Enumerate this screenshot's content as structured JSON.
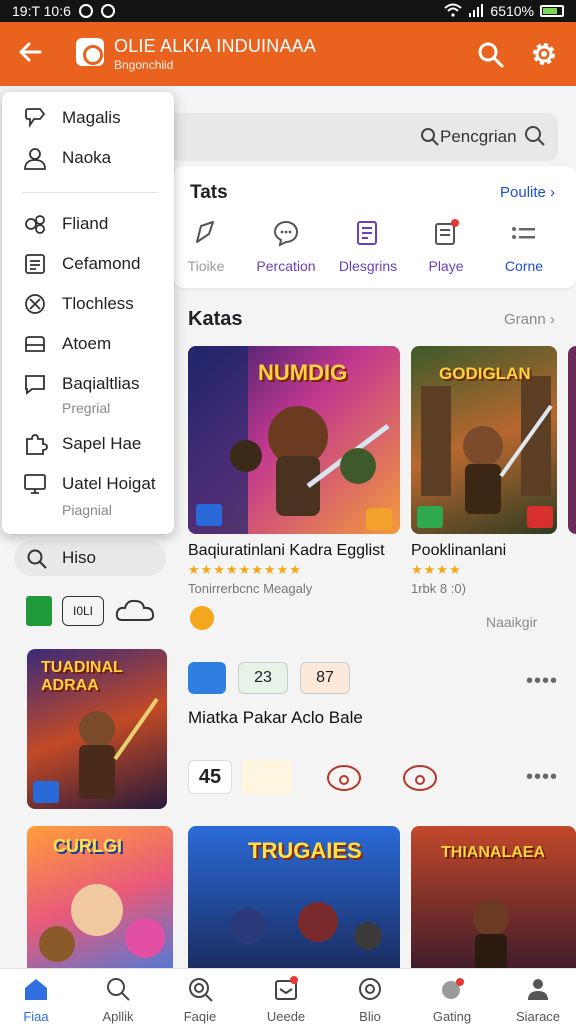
{
  "status_bar": {
    "time": "19:T 10:6",
    "battery": "6510%"
  },
  "app_bar": {
    "title": "OLIE ALKIA INDUINAAA",
    "subtitle": "Bngonchiid"
  },
  "search": {
    "placeholder": "Pencgrian"
  },
  "drawer": {
    "items": [
      {
        "icon": "tag-icon",
        "label": "Magalis"
      },
      {
        "icon": "person-icon",
        "label": "Naoka"
      },
      {
        "icon": "gear-cluster-icon",
        "label": "Fliand"
      },
      {
        "icon": "document-icon",
        "label": "Cefamond"
      },
      {
        "icon": "target-icon",
        "label": "Tlochless"
      },
      {
        "icon": "folder-icon",
        "label": "Atoem"
      },
      {
        "icon": "chat-icon",
        "label": "Baqialtlias",
        "sub": "Pregrial"
      },
      {
        "icon": "puzzle-icon",
        "label": "Sapel Hae"
      },
      {
        "icon": "monitor-icon",
        "label": "Uatel Hoigat",
        "sub": "Piagnial"
      }
    ]
  },
  "categories_card": {
    "title": "Tats",
    "link": "Poulite",
    "items": [
      {
        "label": "Tioike",
        "icon": "tag-icon"
      },
      {
        "label": "Percation",
        "icon": "chat-bubble-icon"
      },
      {
        "label": "Dlesgrins",
        "icon": "list-icon"
      },
      {
        "label": "Playe",
        "icon": "clipboard-icon"
      },
      {
        "label": "Corne",
        "icon": "menu-dots-icon"
      }
    ]
  },
  "section_katas": {
    "title": "Katas",
    "more": "Grann",
    "games": [
      {
        "art_title": "NUMDIG",
        "title": "Baqiuratinlani Kadra Egglist",
        "stars": "★★★★★★★★★",
        "meta": "Tonirrerbcnc Meagaly"
      },
      {
        "art_title": "GODIGLAN",
        "title": "Pooklinanlani",
        "stars": "★★★★",
        "meta": "1rbk 8 :0)"
      }
    ],
    "ad_tag": "Naaikgir"
  },
  "side": {
    "hiso_label": "Hiso",
    "mini_badge": "I0LI"
  },
  "apps_row": {
    "items": [
      {
        "text": ""
      },
      {
        "text": "23"
      },
      {
        "text": "87"
      }
    ],
    "title": "Miatka Pakar Aclo Bale",
    "second_row_text": "45"
  },
  "left_poster": {
    "art_title": "TUADINAL ADRAA"
  },
  "bottom_posters": [
    {
      "art_title": "CURLGI"
    },
    {
      "art_title": "TRUGAIES"
    },
    {
      "art_title": "THIANALAEA"
    }
  ],
  "bottom_nav": {
    "items": [
      {
        "label": "Fiaa",
        "icon": "home-icon",
        "active": true
      },
      {
        "label": "Apllik",
        "icon": "search-icon"
      },
      {
        "label": "Faqie",
        "icon": "magnifier-doc-icon"
      },
      {
        "label": "Ueede",
        "icon": "inbox-icon"
      },
      {
        "label": "Blio",
        "icon": "circle-icon"
      },
      {
        "label": "Gating",
        "icon": "game-icon"
      },
      {
        "label": "Siarace",
        "icon": "profile-icon"
      }
    ]
  },
  "colors": {
    "accent": "#e9631f",
    "link": "#1e4dd8",
    "purple": "#6a3fbf",
    "active_nav": "#2f6fe0"
  }
}
